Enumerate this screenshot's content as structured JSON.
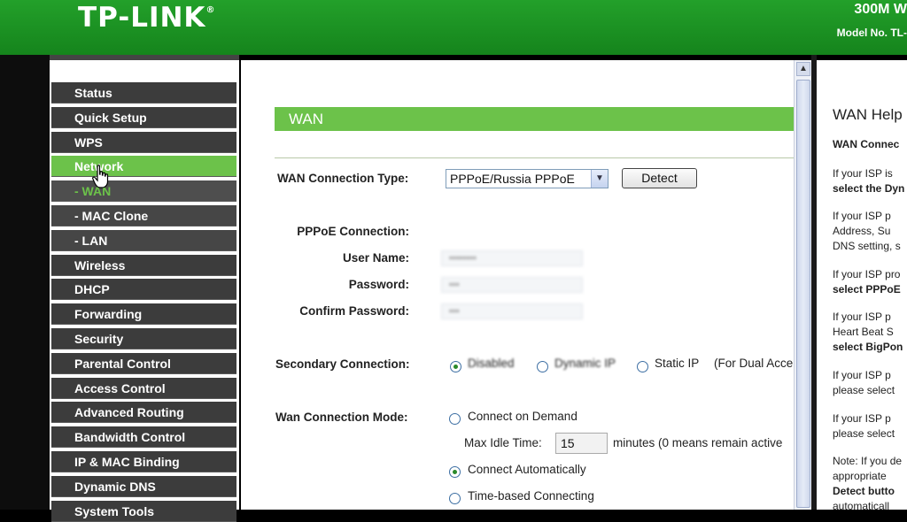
{
  "header": {
    "logo": "TP-LINK",
    "logo_mark": "®",
    "product": "300M W",
    "model": "Model No. TL-"
  },
  "menu": [
    {
      "label": "Status",
      "state": "normal"
    },
    {
      "label": "Quick Setup",
      "state": "normal"
    },
    {
      "label": "WPS",
      "state": "normal"
    },
    {
      "label": "Network",
      "state": "active"
    },
    {
      "label": "- WAN",
      "state": "active-sub"
    },
    {
      "label": "- MAC Clone",
      "state": "sub"
    },
    {
      "label": "- LAN",
      "state": "sub"
    },
    {
      "label": "Wireless",
      "state": "normal"
    },
    {
      "label": "DHCP",
      "state": "normal"
    },
    {
      "label": "Forwarding",
      "state": "normal"
    },
    {
      "label": "Security",
      "state": "normal"
    },
    {
      "label": "Parental Control",
      "state": "normal"
    },
    {
      "label": "Access Control",
      "state": "normal"
    },
    {
      "label": "Advanced Routing",
      "state": "normal"
    },
    {
      "label": "Bandwidth Control",
      "state": "normal"
    },
    {
      "label": "IP & MAC Binding",
      "state": "normal"
    },
    {
      "label": "Dynamic DNS",
      "state": "normal"
    },
    {
      "label": "System Tools",
      "state": "normal"
    }
  ],
  "wan": {
    "section_title": "WAN",
    "connection_type_label": "WAN Connection Type:",
    "connection_type_value": "PPPoE/Russia PPPoE",
    "detect_label": "Detect",
    "pppoe_label": "PPPoE Connection:",
    "username_label": "User Name:",
    "password_label": "Password:",
    "confirm_label": "Confirm Password:",
    "secondary_label": "Secondary Connection:",
    "secondary_options": [
      "Disabled",
      "Dynamic IP",
      "Static IP"
    ],
    "secondary_note": "(For Dual Acce",
    "secondary_selected": "Disabled",
    "mode_label": "Wan Connection Mode:",
    "mode_on_demand": "Connect on Demand",
    "max_idle_label": "Max Idle Time:",
    "max_idle_value": "15",
    "max_idle_note": "minutes (0 means remain active",
    "mode_auto": "Connect Automatically",
    "mode_time": "Time-based Connecting",
    "mode_selected": "Connect Automatically"
  },
  "help": {
    "title": "WAN Help",
    "subtitle": "WAN Connec",
    "p1_line1": "If your ISP is",
    "p1_line2": "select the Dyn",
    "p2_line1": "If your ISP p",
    "p2_line2": "Address, Su",
    "p2_line3": "DNS setting, s",
    "p3_line1": "If your ISP pro",
    "p3_line2": "select PPPoE",
    "p4_line1": "If your ISP p",
    "p4_line2": "Heart Beat S",
    "p4_line3": "select BigPon",
    "p5_line1": "If your ISP p",
    "p5_line2": "please select",
    "p6_line1": "If your ISP p",
    "p6_line2": "please select",
    "note_line1": "Note: If you de",
    "note_line2": "appropriate",
    "note_line3": "Detect butto",
    "note_line4": "automaticall"
  }
}
